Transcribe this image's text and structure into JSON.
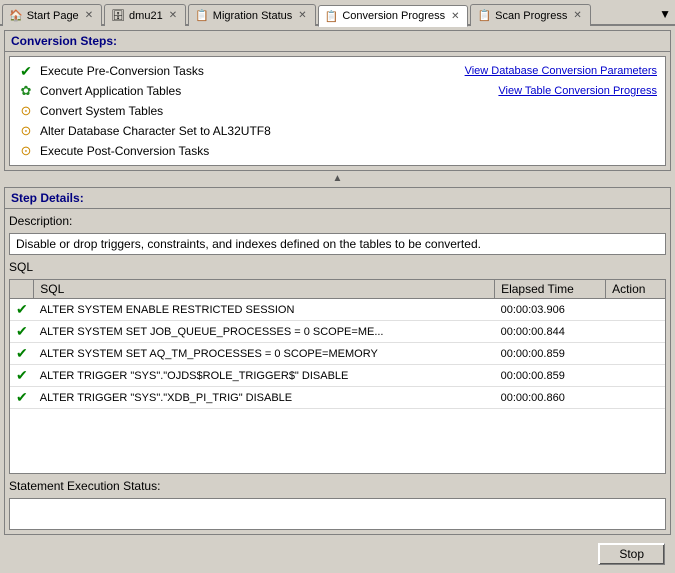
{
  "tabs": [
    {
      "id": "start-page",
      "label": "Start Page",
      "icon": "🏠",
      "active": false,
      "closable": true
    },
    {
      "id": "dmu21",
      "label": "dmu21",
      "icon": "🗄",
      "active": false,
      "closable": true
    },
    {
      "id": "migration-status",
      "label": "Migration Status",
      "icon": "📋",
      "active": false,
      "closable": true
    },
    {
      "id": "conversion-progress",
      "label": "Conversion Progress",
      "icon": "📋",
      "active": true,
      "closable": true
    },
    {
      "id": "scan-progress",
      "label": "Scan Progress",
      "icon": "📋",
      "active": false,
      "closable": true
    }
  ],
  "conversion_steps": {
    "section_title": "Conversion Steps:",
    "steps": [
      {
        "id": "s1",
        "icon": "check",
        "label": "Execute Pre-Conversion Tasks",
        "link": "View Database Conversion Parameters",
        "status": "done"
      },
      {
        "id": "s2",
        "icon": "spinner",
        "label": "Convert Application Tables",
        "link": "View Table Conversion Progress",
        "status": "running"
      },
      {
        "id": "s3",
        "icon": "warn",
        "label": "Convert System Tables",
        "link": null,
        "status": "pending"
      },
      {
        "id": "s4",
        "icon": "warn",
        "label": "Alter Database Character Set to AL32UTF8",
        "link": null,
        "status": "pending"
      },
      {
        "id": "s5",
        "icon": "warn",
        "label": "Execute Post-Conversion Tasks",
        "link": null,
        "status": "pending"
      }
    ]
  },
  "step_details": {
    "section_title": "Step Details:",
    "description_label": "Description:",
    "description_value": "Disable or drop triggers, constraints, and indexes defined on the tables to be converted.",
    "sql_label": "SQL",
    "table_headers": [
      "SQL",
      "Elapsed Time",
      "Action"
    ],
    "sql_rows": [
      {
        "status": "check",
        "sql": "ALTER SYSTEM ENABLE RESTRICTED SESSION",
        "elapsed": "00:00:03.906",
        "action": ""
      },
      {
        "status": "check",
        "sql": "ALTER SYSTEM SET JOB_QUEUE_PROCESSES = 0 SCOPE=ME...",
        "elapsed": "00:00:00.844",
        "action": ""
      },
      {
        "status": "check",
        "sql": "ALTER SYSTEM SET AQ_TM_PROCESSES = 0 SCOPE=MEMORY",
        "elapsed": "00:00:00.859",
        "action": ""
      },
      {
        "status": "check",
        "sql": "ALTER TRIGGER \"SYS\".\"OJDS$ROLE_TRIGGER$\" DISABLE",
        "elapsed": "00:00:00.859",
        "action": ""
      },
      {
        "status": "check",
        "sql": "ALTER TRIGGER \"SYS\".\"XDB_PI_TRIG\" DISABLE",
        "elapsed": "00:00:00.860",
        "action": ""
      }
    ],
    "stmt_exec_label": "Statement Execution Status:",
    "stmt_exec_value": ""
  },
  "buttons": {
    "stop_label": "Stop"
  }
}
